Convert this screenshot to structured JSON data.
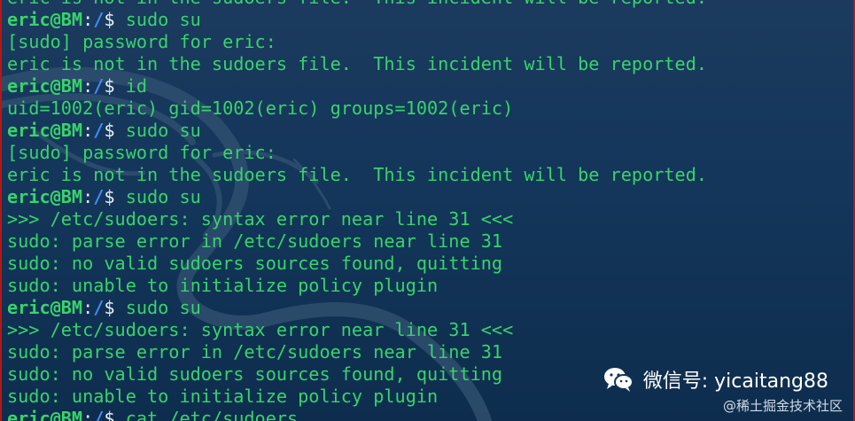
{
  "terminal": {
    "prompt": {
      "user_host": "eric@BM",
      "colon": ":",
      "path": "/",
      "dollar": "$ "
    },
    "lines": [
      {
        "type": "out",
        "text": "eric is not in the sudoers file.  This incident will be reported."
      },
      {
        "type": "cmd",
        "text": "sudo su"
      },
      {
        "type": "out",
        "text": "[sudo] password for eric:"
      },
      {
        "type": "out",
        "text": "eric is not in the sudoers file.  This incident will be reported."
      },
      {
        "type": "cmd",
        "text": "id"
      },
      {
        "type": "out",
        "text": "uid=1002(eric) gid=1002(eric) groups=1002(eric)"
      },
      {
        "type": "cmd",
        "text": "sudo su"
      },
      {
        "type": "out",
        "text": "[sudo] password for eric:"
      },
      {
        "type": "out",
        "text": "eric is not in the sudoers file.  This incident will be reported."
      },
      {
        "type": "cmd",
        "text": "sudo su"
      },
      {
        "type": "out",
        "text": ">>> /etc/sudoers: syntax error near line 31 <<<"
      },
      {
        "type": "out",
        "text": "sudo: parse error in /etc/sudoers near line 31"
      },
      {
        "type": "out",
        "text": "sudo: no valid sudoers sources found, quitting"
      },
      {
        "type": "out",
        "text": "sudo: unable to initialize policy plugin"
      },
      {
        "type": "cmd",
        "text": "sudo su"
      },
      {
        "type": "out",
        "text": ">>> /etc/sudoers: syntax error near line 31 <<<"
      },
      {
        "type": "out",
        "text": "sudo: parse error in /etc/sudoers near line 31"
      },
      {
        "type": "out",
        "text": "sudo: no valid sudoers sources found, quitting"
      },
      {
        "type": "out",
        "text": "sudo: unable to initialize policy plugin"
      },
      {
        "type": "cmd",
        "text": "cat /etc/sudoers"
      }
    ]
  },
  "watermark": {
    "icon": "wechat-icon",
    "text": "微信号: yicaitang88"
  },
  "footer_mark": "@稀土掘金技术社区",
  "colors": {
    "text_green": "#37d46a",
    "path_blue": "#3f8dff",
    "background": "#13365a",
    "border_red": "#b01a1a"
  }
}
